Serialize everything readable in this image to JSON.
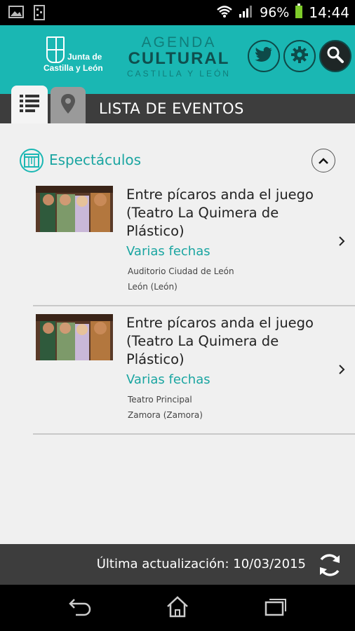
{
  "status_bar": {
    "battery": "96%",
    "time": "14:44"
  },
  "header": {
    "org_line1": "Junta de",
    "org_line2": "Castilla y León",
    "app_line1": "AGENDA",
    "app_line2": "CULTURAL",
    "app_line3": "CASTILLA Y LEÓN",
    "accent": "#1ab7b3"
  },
  "tabs": {
    "title": "LISTA DE EVENTOS"
  },
  "section": {
    "title": "Espectáculos"
  },
  "events": [
    {
      "title": "Entre pícaros anda el juego (Teatro La Quimera de Plástico)",
      "dates": "Varias fechas",
      "venue": "Auditorio Ciudad de León",
      "city": "León (León)"
    },
    {
      "title": "Entre pícaros anda el juego (Teatro La Quimera de Plástico)",
      "dates": "Varias fechas",
      "venue": "Teatro Principal",
      "city": "Zamora (Zamora)"
    }
  ],
  "footer": {
    "last_update": "Última actualización: 10/03/2015"
  }
}
